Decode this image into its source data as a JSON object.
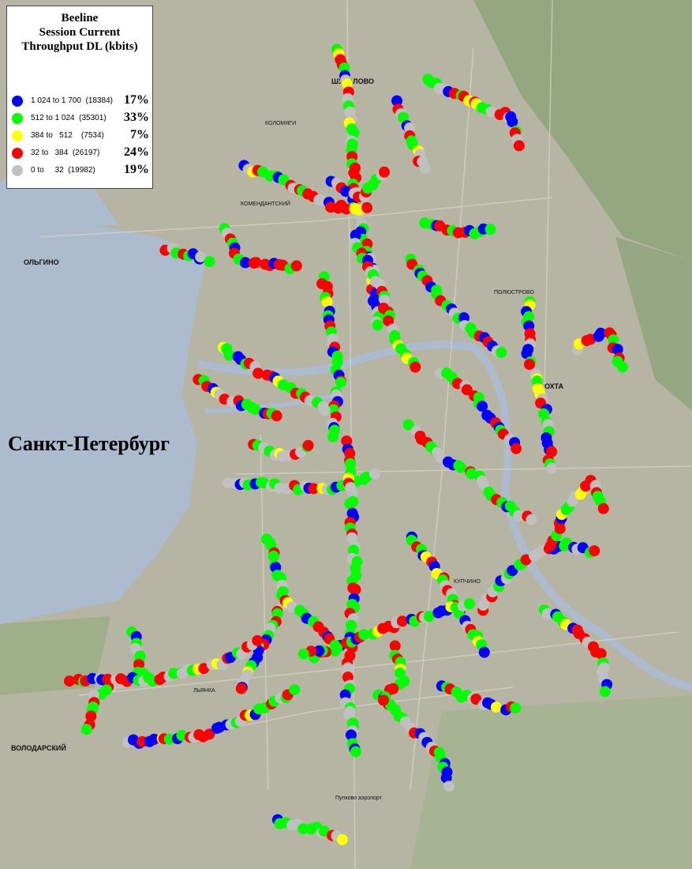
{
  "legend": {
    "title_lines": [
      "Beeline",
      "Session Current",
      "Throughput DL (kbits)"
    ],
    "rows": [
      {
        "color": "#0000ff",
        "range": "1 024 to 1 700  (18384)",
        "percent": "17%"
      },
      {
        "color": "#00ff00",
        "range": "512 to 1 024  (35301)",
        "percent": "33%"
      },
      {
        "color": "#ffff00",
        "range": "384 to   512    (7534)",
        "percent": "7%"
      },
      {
        "color": "#ff0000",
        "range": "32 to   384  (26197)",
        "percent": "24%"
      },
      {
        "color": "#c0c0c0",
        "range": "0 to     32  (19982)",
        "percent": "19%"
      }
    ]
  },
  "city_label": "Санкт-Петербург",
  "place_labels": [
    "ШУВАЛОВО",
    "КОЛОМЯГИ",
    "ОЛЬГИНО",
    "КОМЕНДАНТСКИЙ",
    "ПОЛЮСТРОВО",
    "ОХТА",
    "КУПЧИНО",
    "ВОЛОДАРСКИЙ",
    "Пулково аэропорт",
    "ЛЬЯНКА"
  ],
  "colors": {
    "water": "#aebccf",
    "land": "#b9b7a6",
    "green": "#8fa67a"
  }
}
